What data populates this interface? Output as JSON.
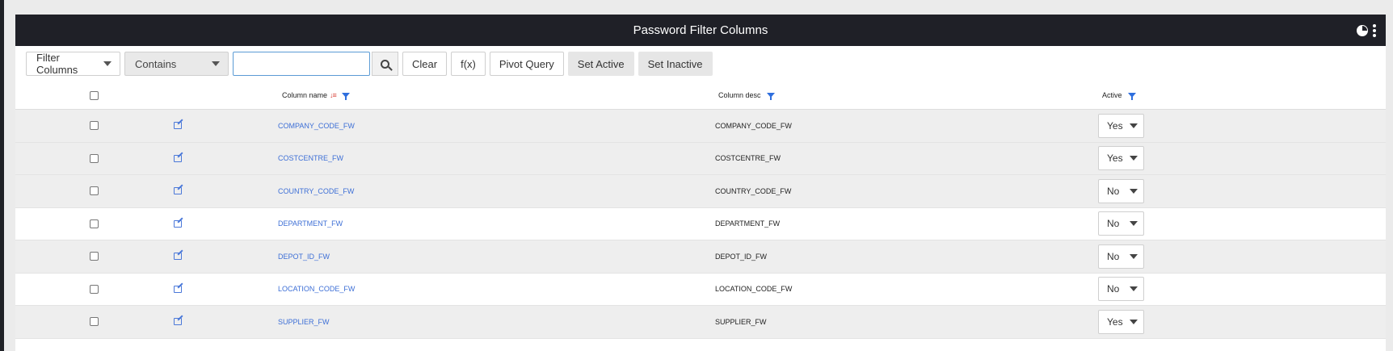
{
  "panel": {
    "title": "Password Filter Columns"
  },
  "toolbar": {
    "filter_select": "Filter Columns",
    "operator_select": "Contains",
    "search_value": "",
    "clear_label": "Clear",
    "fx_label": "f(x)",
    "pivot_label": "Pivot Query",
    "set_active_label": "Set Active",
    "set_inactive_label": "Set Inactive"
  },
  "table": {
    "headers": {
      "column_name": "Column name",
      "column_desc": "Column desc",
      "active": "Active"
    },
    "rows": [
      {
        "name": "COMPANY_CODE_FW",
        "desc": "COMPANY_CODE_FW",
        "active": "Yes"
      },
      {
        "name": "COSTCENTRE_FW",
        "desc": "COSTCENTRE_FW",
        "active": "Yes"
      },
      {
        "name": "COUNTRY_CODE_FW",
        "desc": "COUNTRY_CODE_FW",
        "active": "No"
      },
      {
        "name": "DEPARTMENT_FW",
        "desc": "DEPARTMENT_FW",
        "active": "No"
      },
      {
        "name": "DEPOT_ID_FW",
        "desc": "DEPOT_ID_FW",
        "active": "No"
      },
      {
        "name": "LOCATION_CODE_FW",
        "desc": "LOCATION_CODE_FW",
        "active": "No"
      },
      {
        "name": "SUPPLIER_FW",
        "desc": "SUPPLIER_FW",
        "active": "Yes"
      }
    ]
  },
  "colors": {
    "titlebar": "#1f2027",
    "link": "#3d6fd6",
    "filter_icon": "#2f6fde",
    "sort_icon": "#d9453d"
  }
}
